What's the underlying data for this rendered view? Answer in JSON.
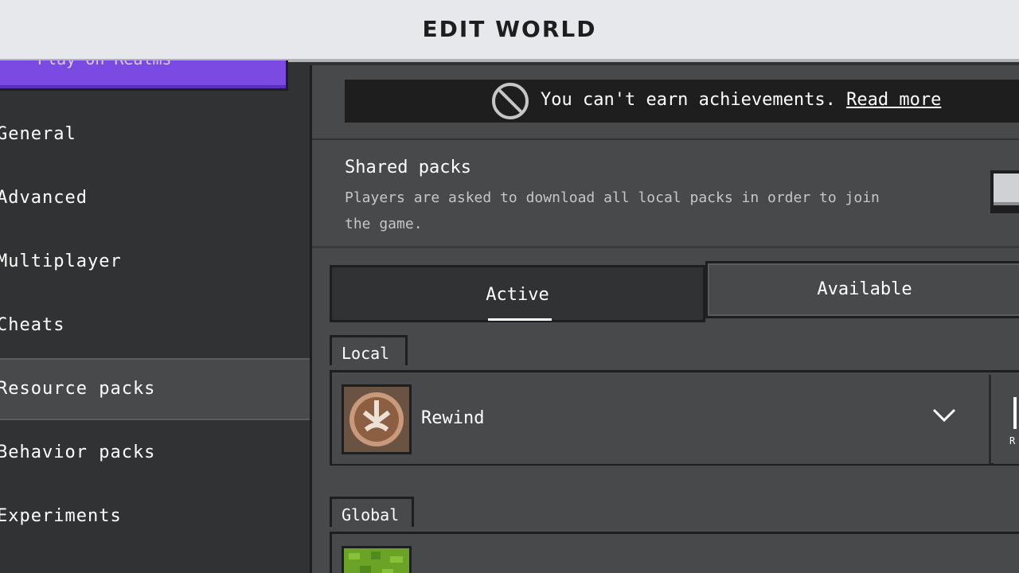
{
  "title": "EDIT WORLD",
  "sidebar": {
    "play_button_label": "Play on Realms",
    "items": [
      {
        "label": "General"
      },
      {
        "label": "Advanced"
      },
      {
        "label": "Multiplayer"
      },
      {
        "label": "Cheats"
      },
      {
        "label": "Resource packs"
      },
      {
        "label": "Behavior packs"
      },
      {
        "label": "Experiments"
      }
    ],
    "selected": "Resource packs"
  },
  "banner": {
    "message": "You can't earn achievements. ",
    "link": "Read more",
    "icon": "no-achievements-icon"
  },
  "shared_packs": {
    "title": "Shared packs",
    "description": "Players are asked to download all local packs in order to join the game."
  },
  "tabs": {
    "active": "Active",
    "available": "Available"
  },
  "sections": {
    "local": {
      "label": "Local",
      "packs": [
        {
          "name": "Rewind",
          "icon": "rewind-pack-icon"
        }
      ]
    },
    "global": {
      "label": "Global",
      "icon": "grass-block-icon"
    }
  },
  "side_action_label": "R",
  "colors": {
    "title_bar": "#e6e8eb",
    "sidebar_bg": "#313233",
    "main_bg": "#48494a",
    "accent_purple": "#7b4ae3",
    "banner_bg": "#1e1e1f"
  }
}
